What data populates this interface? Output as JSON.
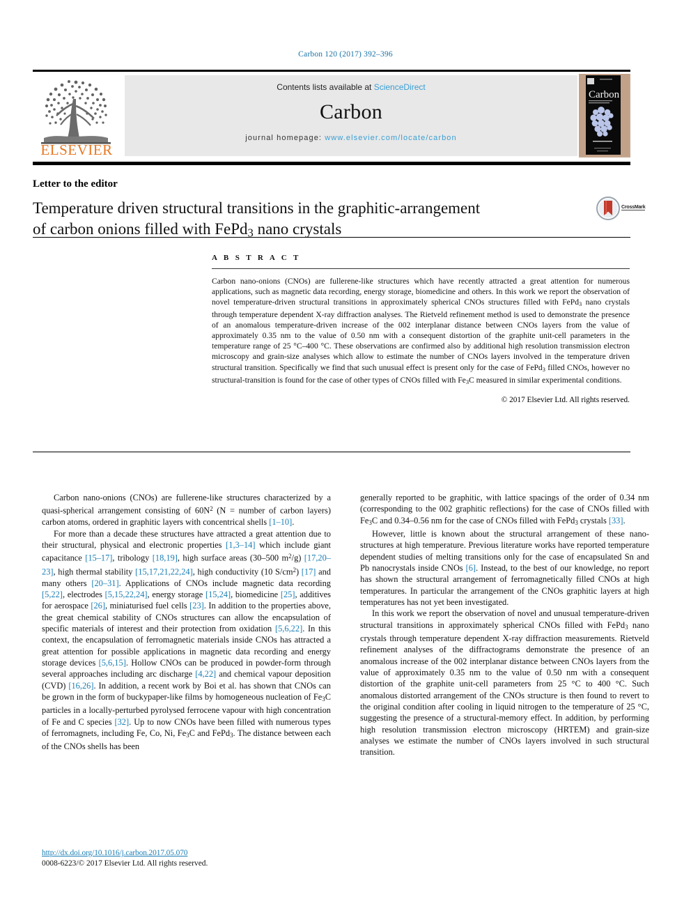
{
  "running_head": "Carbon 120 (2017) 392–396",
  "masthead": {
    "publisher_name": "ELSEVIER",
    "publisher_logo_icon": "elsevier-tree-icon",
    "contents_prefix": "Contents lists available at ",
    "contents_link": "ScienceDirect",
    "journal_name": "Carbon",
    "homepage_prefix": "journal homepage: ",
    "homepage_url": "www.elsevier.com/locate/carbon",
    "cover_title": "Carbon",
    "cover_icon": "journal-cover-thumbnail"
  },
  "article": {
    "type": "Letter to the editor",
    "title_line1": "Temperature driven structural transitions in the graphitic-arrangement",
    "title_line2_pre": "of carbon onions filled with FePd",
    "title_line2_sub": "3",
    "title_line2_post": " nano crystals",
    "crossmark_label": "CrossMark",
    "crossmark_icon": "crossmark-badge-icon"
  },
  "abstract": {
    "heading": "A B S T R A C T",
    "paragraph_1": "Carbon nano-onions (CNOs) are fullerene-like structures which have recently attracted a great attention for numerous applications, such as magnetic data recording, energy storage, biomedicine and others. In this work we report the observation of novel temperature-driven structural transitions in approximately spherical CNOs structures filled with FePd",
    "sub_1": "3",
    "paragraph_2": " nano crystals through temperature dependent X-ray diffraction analyses. The Rietveld refinement method is used to demonstrate the presence of an anomalous temperature-driven increase of the 002 interplanar distance between CNOs layers from the value of approximately 0.35 nm to the value of 0.50 nm with a consequent distortion of the graphite unit-cell parameters in the temperature range of 25 °C–400 °C. These observations are confirmed also by additional high resolution transmission electron microscopy and grain-size analyses which allow to estimate the number of CNOs layers involved in the temperature driven structural transition. Specifically we find that such unusual effect is present only for the case of FePd",
    "sub_2": "3",
    "paragraph_3": " filled CNOs, however no structural-transition is found for the case of other types of CNOs filled with Fe",
    "sub_3": "3",
    "paragraph_4": "C measured in similar experimental conditions.",
    "copyright": "© 2017 Elsevier Ltd. All rights reserved."
  },
  "body": {
    "left_column": {
      "p1_a": "Carbon nano-onions (CNOs) are fullerene-like structures characterized by a quasi-spherical arrangement consisting of 60N",
      "p1_sup": "2",
      "p1_b": " (N = number of carbon layers) carbon atoms, ordered in graphitic layers with concentrical shells ",
      "p1_ref": "[1–10]",
      "p1_c": ".",
      "p2_a": "For more than a decade these structures have attracted a great attention due to their structural, physical and electronic properties ",
      "p2_ref1": "[1,3–14]",
      "p2_b": " which include giant capacitance ",
      "p2_ref2": "[15–17]",
      "p2_c": ", tribology ",
      "p2_ref3": "[18,19]",
      "p2_d": ", high surface areas (30–500 m",
      "p2_sup1": "2",
      "p2_e": "/g) ",
      "p2_ref4": "[17,20–23]",
      "p2_f": ", high thermal stability ",
      "p2_ref5": "[15,17,21,22,24]",
      "p2_g": ", high conductivity (10 S/cm",
      "p2_sup2": "2",
      "p2_h": ") ",
      "p2_ref6": "[17]",
      "p2_i": " and many others ",
      "p2_ref7": "[20–31]",
      "p2_j": ". Applications of CNOs include magnetic data recording ",
      "p2_ref8": "[5,22]",
      "p2_k": ", electrodes ",
      "p2_ref9": "[5,15,22,24]",
      "p2_l": ", energy storage ",
      "p2_ref10": "[15,24]",
      "p2_m": ", biomedicine ",
      "p2_ref11": "[25]",
      "p2_n": ", additives for aerospace ",
      "p2_ref12": "[26]",
      "p2_o": ", miniaturised fuel cells ",
      "p2_ref13": "[23]",
      "p2_p": ". In addition to the properties above, the great chemical stability of CNOs structures can allow the encapsulation of specific materials of interest and their protection from oxidation ",
      "p2_ref14": "[5,6,22]",
      "p2_q": ". In this context, the encapsulation of ferromagnetic materials inside CNOs has attracted a great attention for possible applications in magnetic data recording and energy storage devices ",
      "p2_ref15": "[5,6,15]",
      "p2_r": ". Hollow CNOs can be produced in powder-form through several approaches including arc discharge ",
      "p2_ref16": "[4,22]",
      "p2_s": " and chemical vapour deposition (CVD) ",
      "p2_ref17": "[16,26]",
      "p2_t": ". In addition, a recent work by Boi et al. has shown that CNOs can be grown in the form of buckypaper-like films by homogeneous nucleation of Fe",
      "p2_sub1": "3",
      "p2_u": "C particles in a locally-perturbed pyrolysed ferrocene vapour with high concentration of Fe and C species ",
      "p2_ref18": "[32]",
      "p2_v": ". Up to now CNOs have been filled with numerous types of ferromagnets, including Fe, Co, Ni, Fe",
      "p2_sub2": "3",
      "p2_w": "C and FePd",
      "p2_sub3": "3",
      "p2_x": ". The distance between each of the CNOs shells has been"
    },
    "right_column": {
      "p1_a": "generally reported to be graphitic, with lattice spacings of the order of 0.34 nm (corresponding to the 002 graphitic reflections) for the case of CNOs filled with Fe",
      "p1_sub1": "3",
      "p1_b": "C and 0.34–0.56 nm for the case of CNOs filled with FePd",
      "p1_sub2": "3",
      "p1_c": " crystals ",
      "p1_ref": "[33]",
      "p1_d": ".",
      "p2_a": "However, little is known about the structural arrangement of these nano-structures at high temperature. Previous literature works have reported temperature dependent studies of melting transitions only for the case of encapsulated Sn and Pb nanocrystals inside CNOs ",
      "p2_ref": "[6]",
      "p2_b": ". Instead, to the best of our knowledge, no report has shown the structural arrangement of ferromagnetically filled CNOs at high temperatures. In particular the arrangement of the CNOs graphitic layers at high temperatures has not yet been investigated.",
      "p3_a": "In this work we report the observation of novel and unusual temperature-driven structural transitions in approximately spherical CNOs filled with FePd",
      "p3_sub": "3",
      "p3_b": " nano crystals through temperature dependent X-ray diffraction measurements. Rietveld refinement analyses of the diffractograms demonstrate the presence of an anomalous increase of the 002 interplanar distance between CNOs layers from the value of approximately 0.35 nm to the value of 0.50 nm with a consequent distortion of the graphite unit-cell parameters from 25 °C to 400 °C. Such anomalous distorted arrangement of the CNOs structure is then found to revert to the original condition after cooling in liquid nitrogen to the temperature of 25 °C, suggesting the presence of a structural-memory effect. In addition, by performing high resolution transmission electron microscopy (HRTEM) and grain-size analyses we estimate the number of CNOs layers involved in such structural transition."
    }
  },
  "footer": {
    "doi": "http://dx.doi.org/10.1016/j.carbon.2017.05.070",
    "issn_line": "0008-6223/© 2017 Elsevier Ltd. All rights reserved."
  },
  "colors": {
    "link_blue": "#1a7eb5",
    "elsevier_orange": "#E87722",
    "band_gray": "#e8e8e8"
  }
}
